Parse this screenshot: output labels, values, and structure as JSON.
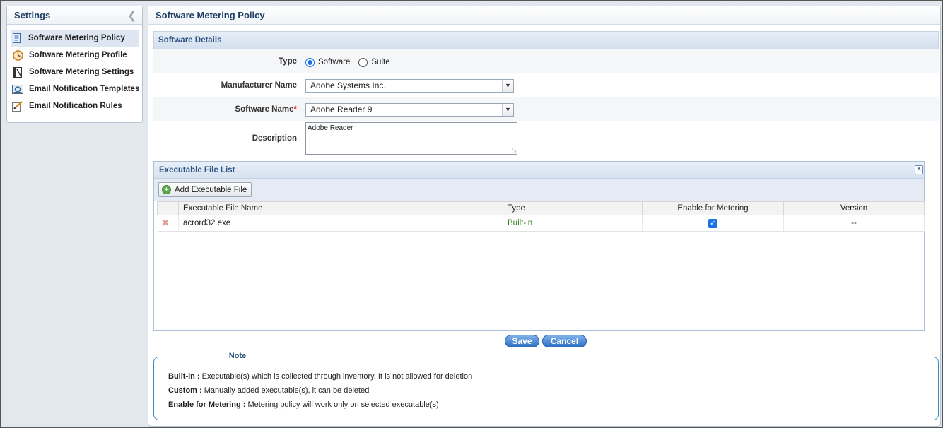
{
  "sidebar": {
    "title": "Settings",
    "items": [
      {
        "label": "Software Metering Policy",
        "icon": "policy-document-icon"
      },
      {
        "label": "Software Metering Profile",
        "icon": "clock-icon"
      },
      {
        "label": "Software Metering Settings",
        "icon": "settings-book-icon"
      },
      {
        "label": "Email Notification Templates",
        "icon": "email-template-icon"
      },
      {
        "label": "Email Notification Rules",
        "icon": "edit-rules-icon"
      }
    ]
  },
  "main": {
    "title": "Software Metering Policy",
    "section_title": "Software Details",
    "form": {
      "type_label": "Type",
      "type_options": [
        "Software",
        "Suite"
      ],
      "type_selected": "Software",
      "manufacturer_label": "Manufacturer Name",
      "manufacturer_value": "Adobe Systems Inc.",
      "software_label": "Software Name",
      "software_required": "*",
      "software_value": "Adobe Reader 9",
      "description_label": "Description",
      "description_value": "Adobe Reader"
    },
    "exec_list": {
      "title": "Executable File List",
      "add_button": "Add Executable File",
      "columns": [
        "Executable File Name",
        "Type",
        "Enable for Metering",
        "Version"
      ],
      "rows": [
        {
          "name": "acrord32.exe",
          "type": "Built-in",
          "enabled": true,
          "version": "--"
        }
      ]
    },
    "buttons": {
      "save": "Save",
      "cancel": "Cancel"
    },
    "note": {
      "legend": "Note",
      "lines": [
        {
          "term": "Built-in :",
          "text": " Executable(s) which is collected through inventory. It is not allowed for deletion"
        },
        {
          "term": "Custom :",
          "text": " Manually added executable(s), it can be deleted"
        },
        {
          "term": "Enable for Metering :",
          "text": " Metering policy will work only on selected executable(s)"
        }
      ]
    }
  },
  "colors": {
    "accent": "#1a73e8",
    "builtin": "#2e7d1b",
    "header_text": "#1f3f66"
  }
}
